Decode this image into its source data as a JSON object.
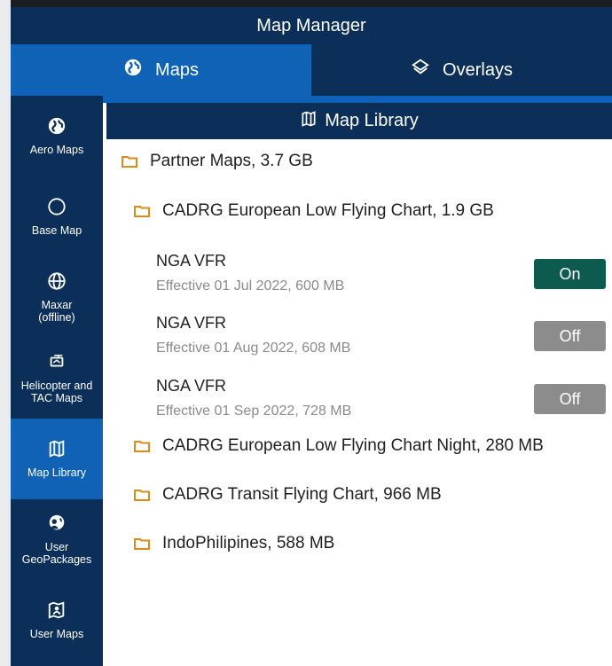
{
  "title": "Map Manager",
  "tabs": [
    {
      "label": "Maps",
      "icon": "globe-icon",
      "active": true
    },
    {
      "label": "Overlays",
      "icon": "layers-icon",
      "active": false
    }
  ],
  "sidebar": {
    "items": [
      {
        "label": "Aero Maps",
        "icon": "globe-icon"
      },
      {
        "label": "Base Map",
        "icon": "circle-icon"
      },
      {
        "label": "Maxar (offline)",
        "icon": "globe-grid-icon"
      },
      {
        "label": "Helicopter and TAC Maps",
        "icon": "helicopter-icon"
      },
      {
        "label": "Map Library",
        "icon": "map-library-icon",
        "active": true
      },
      {
        "label": "User GeoPackages",
        "icon": "user-geopackage-icon"
      },
      {
        "label": "User Maps",
        "icon": "user-map-icon"
      }
    ]
  },
  "library": {
    "header": "Map Library",
    "partner_folder": "Partner Maps, 3.7 GB",
    "cadrg_folder": "CADRG European Low Flying Chart, 1.9 GB",
    "maps": [
      {
        "title": "NGA VFR",
        "subtitle": "Effective 01 Jul 2022, 600 MB",
        "toggle": "On"
      },
      {
        "title": "NGA VFR",
        "subtitle": "Effective 01 Aug 2022, 608 MB",
        "toggle": "Off"
      },
      {
        "title": "NGA VFR",
        "subtitle": "Effective 01 Sep 2022, 728 MB",
        "toggle": "Off"
      }
    ],
    "other_folders": [
      "CADRG European Low Flying Chart Night, 280 MB",
      "CADRG Transit Flying Chart, 966 MB",
      "IndoPhilipines, 588 MB"
    ]
  },
  "colors": {
    "navy": "#0c2f59",
    "accent_blue": "#0f62b5",
    "toggle_on": "#0d5a4e",
    "toggle_off": "#8c8c8c",
    "folder": "#d98c1a"
  }
}
